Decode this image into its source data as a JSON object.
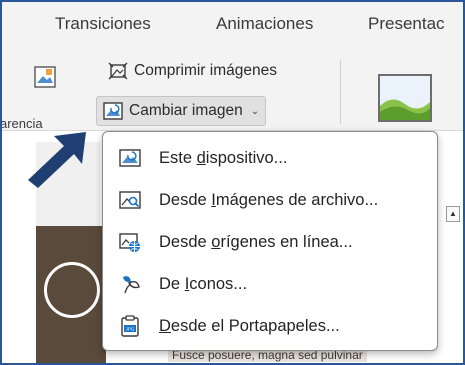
{
  "ribbon_tabs": [
    "Transiciones",
    "Animaciones",
    "Presentac"
  ],
  "ribbon": {
    "left_label": "arencia",
    "compress_label": "Comprimir imágenes",
    "change_image_label": "Cambiar imagen",
    "change_image_chevron": "⌄"
  },
  "menu": {
    "items": [
      {
        "pre": "Este ",
        "key": "d",
        "post": "ispositivo...",
        "icon": "picture-device-icon"
      },
      {
        "pre": "Desde ",
        "key": "I",
        "post": "mágenes de archivo...",
        "icon": "stock-images-icon"
      },
      {
        "pre": "Desde ",
        "key": "o",
        "post": "rígenes en línea...",
        "icon": "online-pictures-icon"
      },
      {
        "pre": "De ",
        "key": "I",
        "post": "conos...",
        "icon": "icons-icon"
      },
      {
        "pre": "",
        "key": "D",
        "post": "esde el Portapapeles...",
        "icon": "clipboard-icon"
      }
    ]
  },
  "slide_text": "Fusce posuere, magna sed pulvinar"
}
